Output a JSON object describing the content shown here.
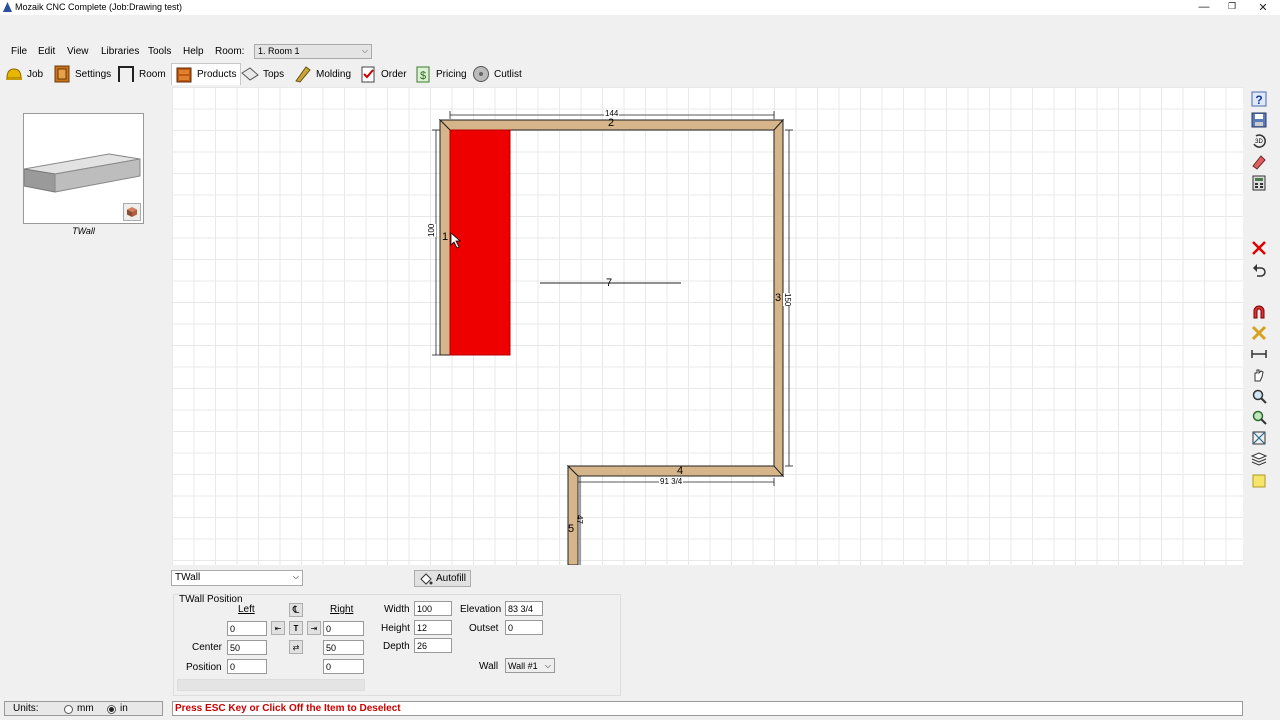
{
  "window": {
    "title": "Mozaik CNC Complete (Job:Drawing test)",
    "minimize": "—",
    "restore": "❐",
    "close": "✕"
  },
  "menu": {
    "items": [
      "File",
      "Edit",
      "View",
      "Libraries",
      "Tools",
      "Help"
    ],
    "room_label": "Room:",
    "room_value": "1. Room 1"
  },
  "toolbar": {
    "items": [
      "Job",
      "Settings",
      "Room",
      "Products",
      "Tops",
      "Molding",
      "Order",
      "Pricing",
      "Cutlist"
    ],
    "active": "Products"
  },
  "thumbnail": {
    "label": "TWall"
  },
  "drawing": {
    "wall_labels": [
      "1",
      "2",
      "3",
      "4",
      "5",
      "7"
    ],
    "dimensions": {
      "top": "144",
      "left": "100",
      "right": "150",
      "bottom": "91 3/4",
      "lower_left": "47"
    }
  },
  "colors": {
    "wall_fill": "#d6b58a",
    "selected_product": "#ee0000",
    "status_text": "#cc0000"
  },
  "product_select": {
    "value": "TWall"
  },
  "autofill_label": "Autofill",
  "position_panel": {
    "title": "TWall Position",
    "left_label": "Left",
    "right_label": "Right",
    "center_symbol": "℄",
    "left_value": "0",
    "right_value": "0",
    "center_label": "Center",
    "center_left_value": "50",
    "center_right_value": "50",
    "position_label": "Position",
    "position_left_value": "0",
    "position_right_value": "0",
    "width_label": "Width",
    "width_value": "100",
    "height_label": "Height",
    "height_value": "12",
    "depth_label": "Depth",
    "depth_value": "26",
    "elevation_label": "Elevation",
    "elevation_value": "83 3/4",
    "outset_label": "Outset",
    "outset_value": "0",
    "wall_label": "Wall",
    "wall_value": "Wall #1"
  },
  "status": {
    "units_label": "Units:",
    "unit_mm": "mm",
    "unit_in": "in",
    "selected_unit": "in",
    "message": "Press ESC Key or Click Off the Item to Deselect"
  },
  "icons": {
    "right_tools": [
      "help-icon",
      "save-icon",
      "rotate-3d-icon",
      "eraser-icon",
      "calculator-icon",
      "delete-icon",
      "undo-icon",
      "magnet-icon",
      "cross-icon",
      "dimension-icon",
      "pan-hand-icon",
      "zoom-in-icon",
      "zoom-fit-icon",
      "zoom-extents-icon",
      "layers-icon",
      "note-icon"
    ]
  }
}
